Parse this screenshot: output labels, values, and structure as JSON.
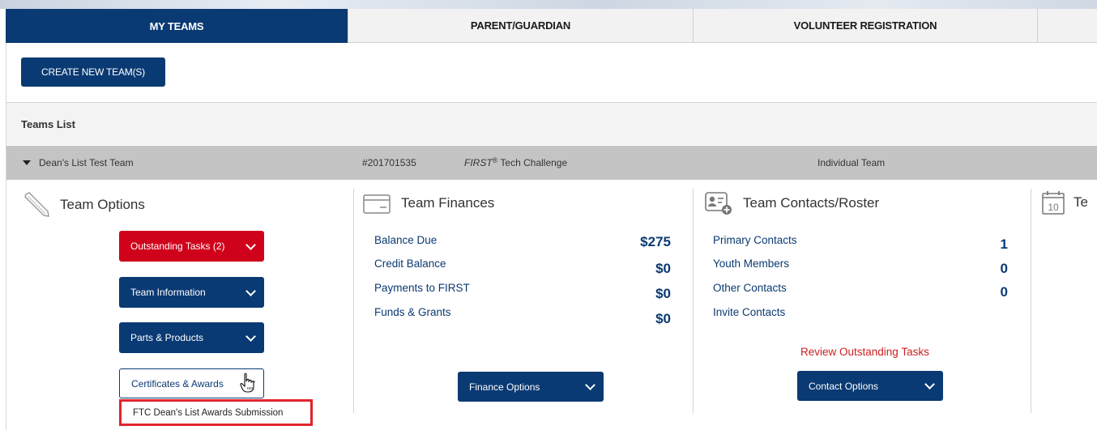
{
  "tabs": [
    {
      "label": "MY TEAMS",
      "active": true
    },
    {
      "label": "PARENT/GUARDIAN",
      "active": false
    },
    {
      "label": "VOLUNTEER REGISTRATION",
      "active": false
    },
    {
      "label": "",
      "active": false
    }
  ],
  "create_button": "CREATE NEW TEAM(S)",
  "teams_list_label": "Teams List",
  "team": {
    "name": "Dean's List Test Team",
    "number": "#201701535",
    "program_first": "FIRST",
    "program_reg": "®",
    "program_rest": " Tech Challenge",
    "type": "Individual Team"
  },
  "team_options": {
    "title": "Team Options",
    "icon": "pencil-icon",
    "outstanding_tasks": "Outstanding Tasks (2)",
    "team_information": "Team Information",
    "parts_products": "Parts & Products",
    "certificates_awards": "Certificates & Awards",
    "submission_link": "FTC Dean's List Awards Submission"
  },
  "finances": {
    "title": "Team Finances",
    "icon": "credit-card-icon",
    "rows": [
      {
        "label": "Balance Due",
        "value": "$275"
      },
      {
        "label": "Credit Balance",
        "value": "$0"
      },
      {
        "label": "Payments to FIRST",
        "value": "$0"
      },
      {
        "label": "Funds & Grants",
        "value": "$0"
      }
    ],
    "options_button": "Finance Options"
  },
  "contacts": {
    "title": "Team Contacts/Roster",
    "icon": "contact-card-add-icon",
    "rows": [
      {
        "label": "Primary Contacts",
        "value": "1"
      },
      {
        "label": "Youth Members",
        "value": "0"
      },
      {
        "label": "Other Contacts",
        "value": "0"
      },
      {
        "label": "Invite Contacts",
        "value": ""
      }
    ],
    "review_link": "Review Outstanding Tasks",
    "options_button": "Contact Options"
  },
  "fourth_column": {
    "title_partial": "Te",
    "icon": "calendar-icon",
    "calendar_day": "10"
  },
  "colors": {
    "navy": "#0a3a73",
    "red": "#d0021b",
    "highlight": "#e0242b",
    "row_gray": "#c4c4c4"
  }
}
